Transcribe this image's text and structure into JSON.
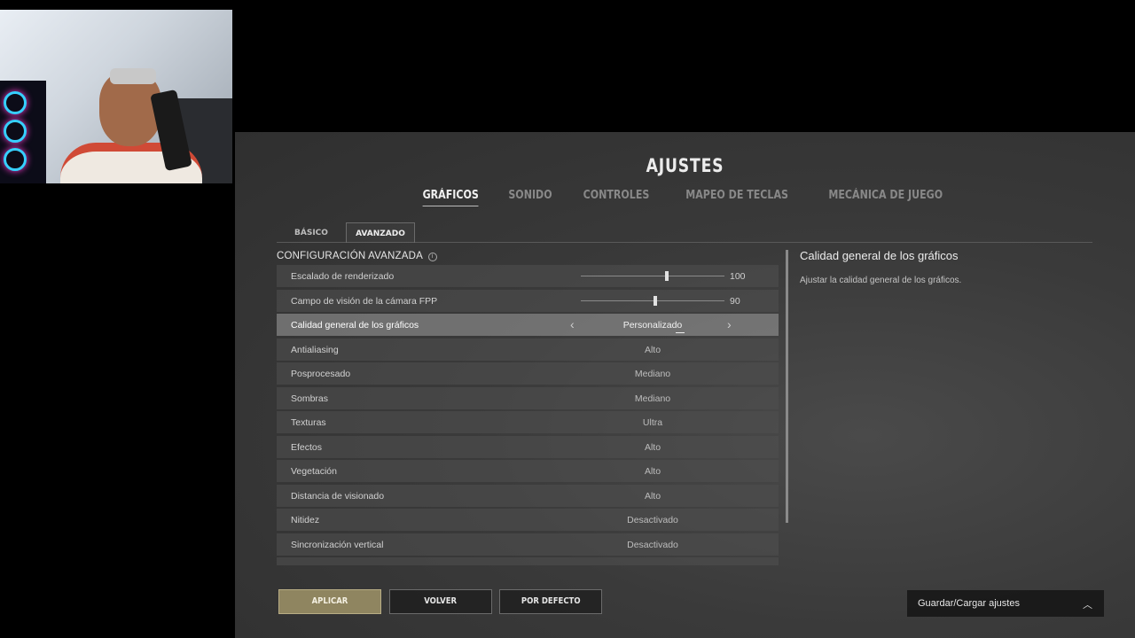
{
  "settings": {
    "title": "AJUSTES",
    "top_tabs": [
      "GRÁFICOS",
      "SONIDO",
      "CONTROLES",
      "MAPEO DE TECLAS",
      "MECÁNICA DE JUEGO"
    ],
    "active_top_tab": "GRÁFICOS",
    "sub_tabs": [
      "BÁSICO",
      "AVANZADO"
    ],
    "active_sub_tab": "AVANZADO",
    "section_title": "CONFIGURACIÓN AVANZADA",
    "rows": [
      {
        "label": "Escalado de renderizado",
        "value": "100",
        "kind": "slider",
        "level": 0.6
      },
      {
        "label": "Campo de visión de la cámara FPP",
        "value": "90",
        "kind": "slider",
        "level": 0.52
      },
      {
        "label": "Calidad general de los gráficos",
        "value": "Personalizado",
        "kind": "selector",
        "selected": true
      },
      {
        "label": "Antialiasing",
        "value": "Alto",
        "kind": "option"
      },
      {
        "label": "Posprocesado",
        "value": "Mediano",
        "kind": "option"
      },
      {
        "label": "Sombras",
        "value": "Mediano",
        "kind": "option"
      },
      {
        "label": "Texturas",
        "value": "Ultra",
        "kind": "option"
      },
      {
        "label": "Efectos",
        "value": "Alto",
        "kind": "option"
      },
      {
        "label": "Vegetación",
        "value": "Alto",
        "kind": "option"
      },
      {
        "label": "Distancia de visionado",
        "value": "Alto",
        "kind": "option"
      },
      {
        "label": "Nitidez",
        "value": "Desactivado",
        "kind": "option"
      },
      {
        "label": "Sincronización vertical",
        "value": "Desactivado",
        "kind": "option"
      }
    ],
    "detail": {
      "title": "Calidad general de los gráficos",
      "description": "Ajustar la calidad general de los gráficos."
    },
    "buttons": {
      "apply": "APLICAR",
      "back": "VOLVER",
      "default": "POR DEFECTO"
    },
    "save_load_label": "Guardar/Cargar ajustes",
    "colors": {
      "accent_button": "#8f8560",
      "selected_row": "#969696"
    },
    "icons": {
      "info": "info-icon",
      "prev": "chevron-left-icon",
      "next": "chevron-right-icon",
      "expand": "chevron-up-icon"
    }
  }
}
